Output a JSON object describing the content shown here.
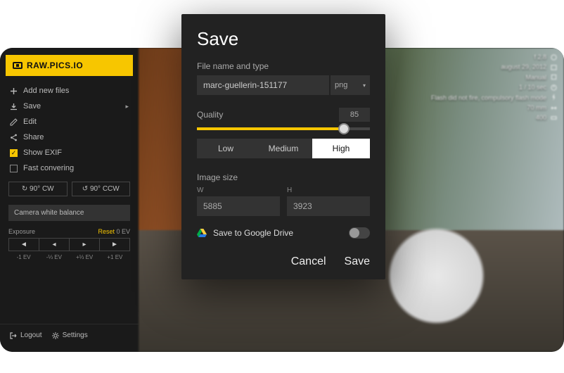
{
  "brand": "RAW.PICS.IO",
  "sidebar": {
    "items": [
      {
        "label": "Add new files",
        "icon": "plus-icon"
      },
      {
        "label": "Save",
        "icon": "download-icon",
        "chevron": true
      },
      {
        "label": "Edit",
        "icon": "pencil-icon"
      },
      {
        "label": "Share",
        "icon": "share-icon"
      },
      {
        "label": "Show EXIF",
        "icon": "checkbox",
        "checked": true
      },
      {
        "label": "Fast convering",
        "icon": "checkbox",
        "checked": false
      }
    ],
    "rotate_cw": "90° CW",
    "rotate_ccw": "90° CCW",
    "white_balance": "Camera white balance",
    "exposure_label": "Exposure",
    "reset_label": "Reset",
    "exposure_value": "0 EV",
    "steps": [
      "◄",
      "◂",
      "▸",
      "►"
    ],
    "step_labels": [
      "-1 EV",
      "-⅓ EV",
      "+⅓ EV",
      "+1 EV"
    ],
    "logout": "Logout",
    "settings": "Settings"
  },
  "exif": [
    {
      "v": "f 2.8",
      "i": "aperture-icon"
    },
    {
      "v": "august 29, 2012",
      "i": "calendar-icon"
    },
    {
      "v": "Manual",
      "i": "mode-icon"
    },
    {
      "v": "1 / 10 sec",
      "i": "shutter-icon"
    },
    {
      "v": "Flash did not fire, compulsory flash mode",
      "i": "flash-icon"
    },
    {
      "v": "70 mm",
      "i": "focal-icon"
    },
    {
      "v": "400",
      "i": "iso-icon"
    }
  ],
  "dialog": {
    "title": "Save",
    "filename_label": "File name and type",
    "filename": "marc-guellerin-151177",
    "type": "png",
    "quality_label": "Quality",
    "quality": "85",
    "quality_levels": [
      "Low",
      "Medium",
      "High"
    ],
    "quality_selected": "High",
    "size_label": "Image size",
    "w_label": "W",
    "h_label": "H",
    "width": "5885",
    "height": "3923",
    "gdrive": "Save to Google Drive",
    "cancel": "Cancel",
    "save": "Save"
  }
}
